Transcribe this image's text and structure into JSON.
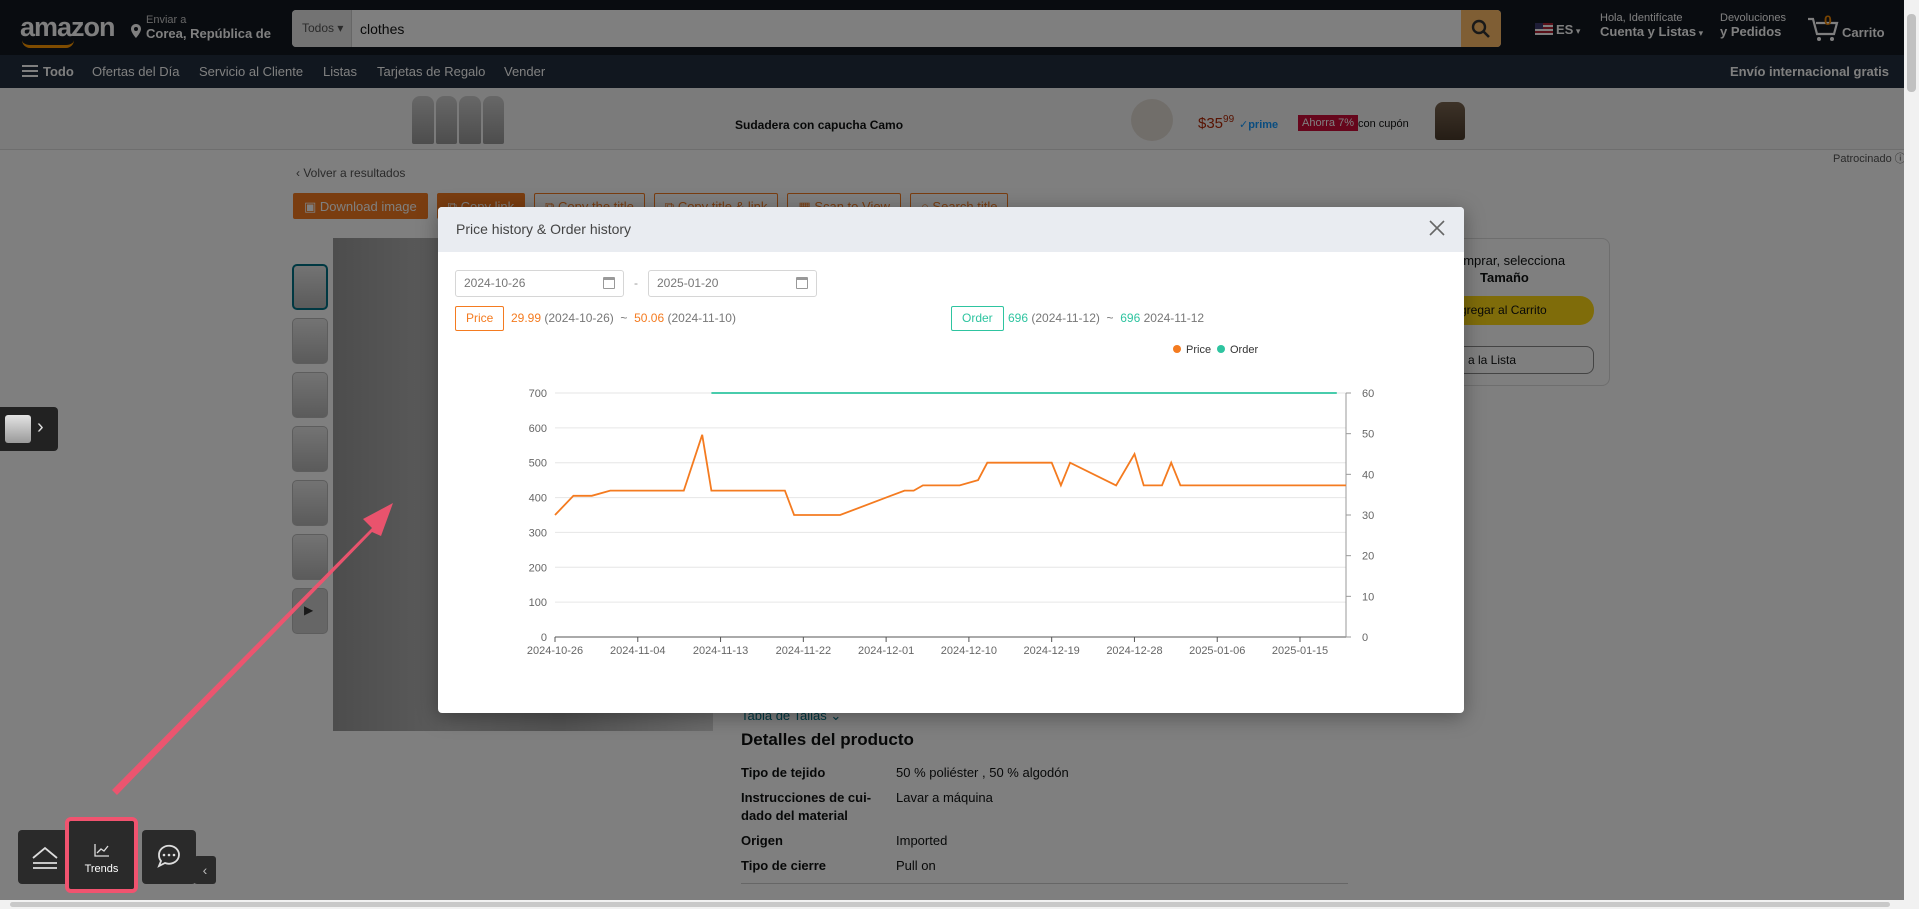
{
  "header": {
    "logo": "amazon",
    "deliver_l1": "Enviar a",
    "deliver_l2": "Corea, República de",
    "search_category": "Todos",
    "search_value": "clothes",
    "lang": "ES",
    "account_l1": "Hola, Identifícate",
    "account_l2": "Cuenta y Listas",
    "orders_l1": "Devoluciones",
    "orders_l2": "y Pedidos",
    "cart_count": "0",
    "cart_label": "Carrito"
  },
  "nav": {
    "items": [
      "Todo",
      "Ofertas del Día",
      "Servicio al Cliente",
      "Listas",
      "Tarjetas de Regalo",
      "Vender"
    ],
    "right": "Envío internacional gratis"
  },
  "banner": {
    "title": "Sudadera con capucha Camo",
    "price_dollars": "$35",
    "price_cents": "99",
    "prime": "✓prime",
    "deal": "Ahorra 7%",
    "coupon": "con cupón",
    "sponsored": "Patrocinado ⓘ"
  },
  "page": {
    "back": "‹ Volver a resultados",
    "toolbar": [
      "Download image",
      "Copy link",
      "Copy the title",
      "Copy title & link",
      "Scan to View",
      "Search title"
    ],
    "buybox_l1": "omprar, selecciona",
    "buybox_l2": "Tamaño",
    "buybox_add": "gregar al Carrito",
    "buybox_list": "a la Lista",
    "size_chart": "Tabla de Tallas",
    "details_title": "Detalles del producto",
    "details": [
      {
        "k": "Tipo de tejido",
        "v": "50 % poliéster , 50 % algodón"
      },
      {
        "k": "Instrucciones de cui-dado del material",
        "v": "Lavar a máquina"
      },
      {
        "k": "Origen",
        "v": "Imported"
      },
      {
        "k": "Tipo de cierre",
        "v": "Pull on"
      }
    ]
  },
  "bottom_toolbar": {
    "trends_label": "Trends"
  },
  "modal": {
    "title": "Price history & Order history",
    "date_from": "2024-10-26",
    "date_to": "2025-01-20",
    "date_sep": "-",
    "price_tag": "Price",
    "price_low": "29.99",
    "price_low_date": "(2024-10-26)",
    "price_sep": "~",
    "price_high": "50.06",
    "price_high_date": "(2024-11-10)",
    "order_tag": "Order",
    "order_low": "696",
    "order_low_date": "(2024-11-12)",
    "order_sep": "~",
    "order_high": "696",
    "order_high_date": "2024-11-12"
  },
  "colors": {
    "price": "#f47b20",
    "order": "#2ec4a0",
    "annotation": "#f1536f"
  },
  "chart_data": {
    "type": "line",
    "legend": [
      "Price",
      "Order"
    ],
    "legend_position": "top-right",
    "x_ticks": [
      "2024-10-26",
      "2024-11-04",
      "2024-11-13",
      "2024-11-22",
      "2024-12-01",
      "2024-12-10",
      "2024-12-19",
      "2024-12-28",
      "2025-01-06",
      "2025-01-15"
    ],
    "x_range": [
      "2024-10-26",
      "2025-01-20"
    ],
    "y_left_ticks": [
      "0",
      "100",
      "200",
      "300",
      "400",
      "500",
      "600",
      "700"
    ],
    "y_left_range": [
      0,
      700
    ],
    "y_right_ticks": [
      "0",
      "10",
      "20",
      "30",
      "40",
      "50",
      "60"
    ],
    "y_right_range": [
      0,
      60
    ],
    "grid": true,
    "series": [
      {
        "name": "Price",
        "axis": "left",
        "points": [
          [
            "2024-10-26",
            350
          ],
          [
            "2024-10-28",
            405
          ],
          [
            "2024-10-30",
            405
          ],
          [
            "2024-11-01",
            420
          ],
          [
            "2024-11-09",
            420
          ],
          [
            "2024-11-11",
            580
          ],
          [
            "2024-11-12",
            420
          ],
          [
            "2024-11-20",
            420
          ],
          [
            "2024-11-21",
            350
          ],
          [
            "2024-11-26",
            350
          ],
          [
            "2024-12-03",
            420
          ],
          [
            "2024-12-04",
            420
          ],
          [
            "2024-12-05",
            435
          ],
          [
            "2024-12-09",
            435
          ],
          [
            "2024-12-11",
            450
          ],
          [
            "2024-12-12",
            500
          ],
          [
            "2024-12-19",
            500
          ],
          [
            "2024-12-20",
            435
          ],
          [
            "2024-12-21",
            500
          ],
          [
            "2024-12-26",
            435
          ],
          [
            "2024-12-28",
            525
          ],
          [
            "2024-12-29",
            435
          ],
          [
            "2024-12-31",
            435
          ],
          [
            "2025-01-01",
            500
          ],
          [
            "2025-01-02",
            435
          ],
          [
            "2025-01-20",
            435
          ]
        ]
      },
      {
        "name": "Order",
        "axis": "right",
        "points": [
          [
            "2024-11-12",
            60
          ],
          [
            "2025-01-19",
            60
          ]
        ]
      }
    ]
  }
}
